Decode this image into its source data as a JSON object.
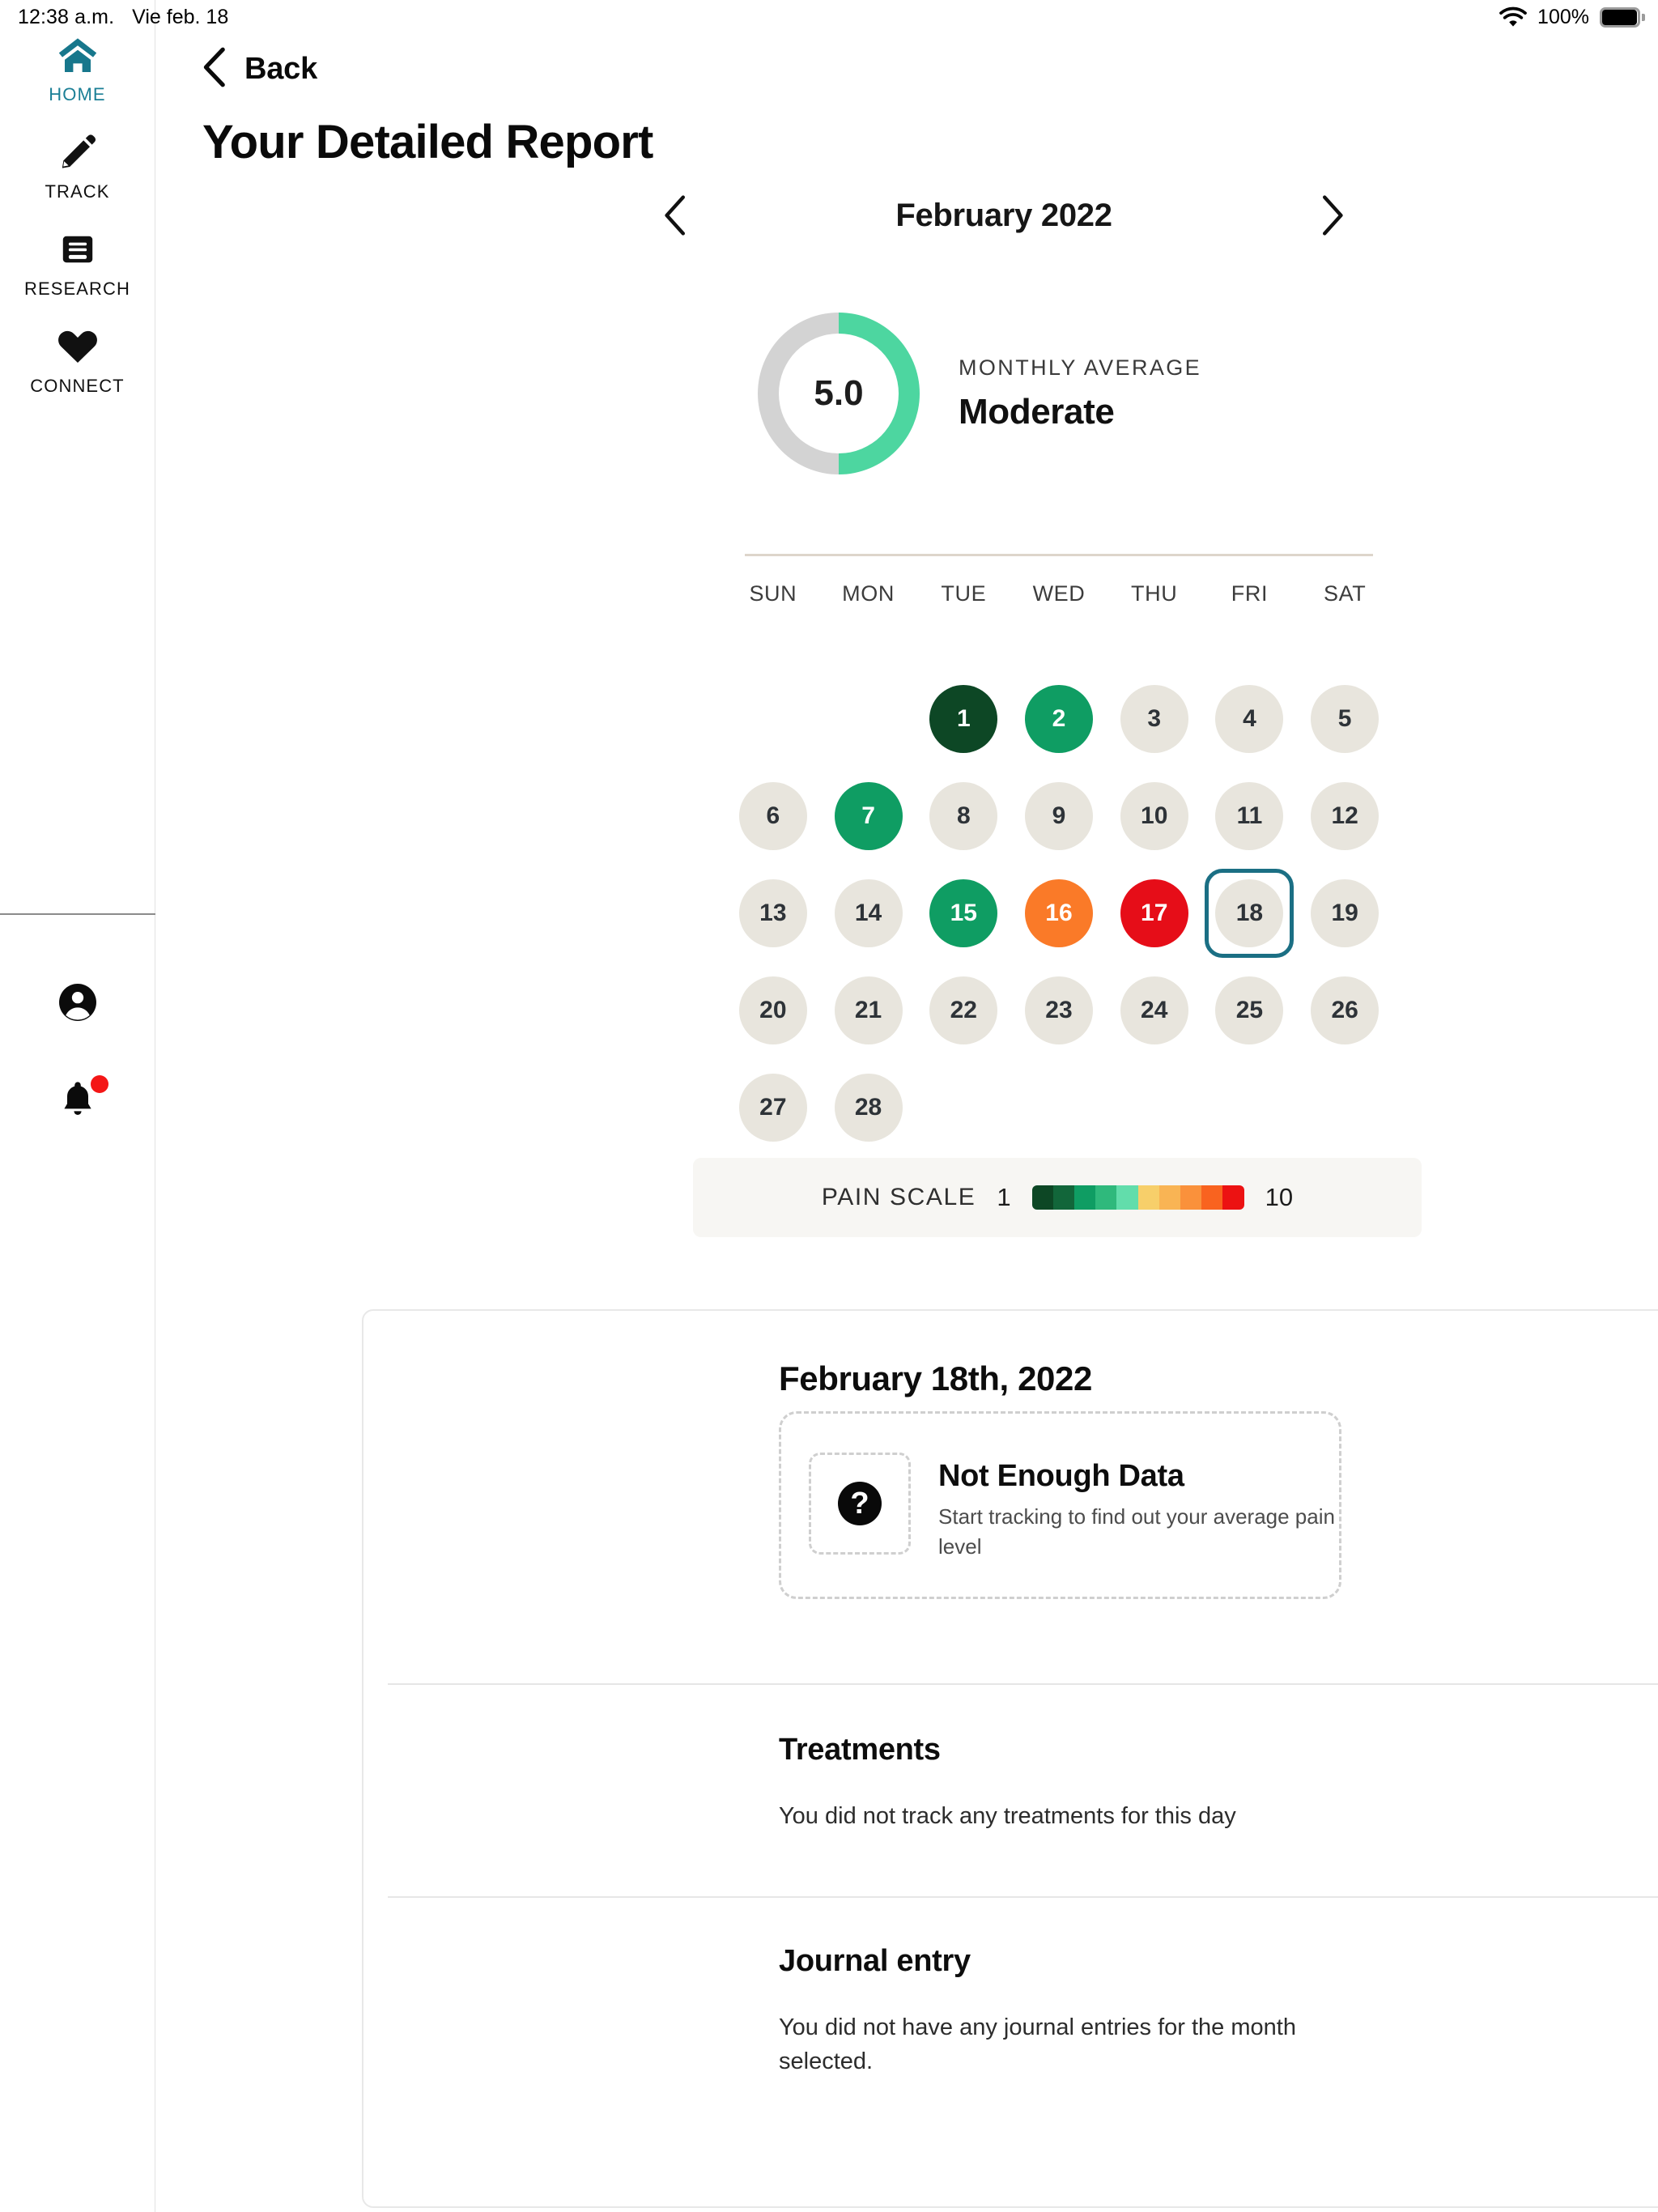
{
  "statusbar": {
    "time": "12:38 a.m.",
    "date": "Vie feb. 18",
    "battery_percent": "100%",
    "wifi_icon": "wifi-icon",
    "battery_icon": "battery-full-icon"
  },
  "sidebar": {
    "items": [
      {
        "label": "HOME",
        "icon": "home-icon",
        "active": true
      },
      {
        "label": "TRACK",
        "icon": "pencil-icon",
        "active": false
      },
      {
        "label": "RESEARCH",
        "icon": "book-icon",
        "active": false
      },
      {
        "label": "CONNECT",
        "icon": "heart-icon",
        "active": false
      }
    ],
    "bottom": [
      {
        "icon": "account-circle-icon",
        "badge": false
      },
      {
        "icon": "bell-icon",
        "badge": true
      }
    ],
    "active_color": "#1b7f96"
  },
  "header": {
    "back_label": "Back",
    "back_icon": "chevron-left-icon",
    "title": "Your Detailed Report"
  },
  "month_nav": {
    "prev_icon": "chevron-left-icon",
    "next_icon": "chevron-right-icon",
    "label": "February 2022"
  },
  "monthly_average": {
    "value": "5.0",
    "caption": "MONTHLY AVERAGE",
    "level": "Moderate",
    "ring_color": "#4dd6a0",
    "track_color": "#d3d3d3",
    "fill_percent": 50
  },
  "calendar": {
    "weekdays": [
      "SUN",
      "MON",
      "TUE",
      "WED",
      "THU",
      "FRI",
      "SAT"
    ],
    "leading_blanks": 2,
    "selected_day": 18,
    "default_color": "#e8e5dd",
    "default_text": "#2e3338",
    "selected_border_color": "#1b6f84",
    "days": [
      {
        "n": 1,
        "color": "#0d4725",
        "text": "#ffffff"
      },
      {
        "n": 2,
        "color": "#0f9d63",
        "text": "#ffffff"
      },
      {
        "n": 3,
        "color": "#e8e5dd",
        "text": "#2e3338"
      },
      {
        "n": 4,
        "color": "#e8e5dd",
        "text": "#2e3338"
      },
      {
        "n": 5,
        "color": "#e8e5dd",
        "text": "#2e3338"
      },
      {
        "n": 6,
        "color": "#e8e5dd",
        "text": "#2e3338"
      },
      {
        "n": 7,
        "color": "#0f9d63",
        "text": "#ffffff"
      },
      {
        "n": 8,
        "color": "#e8e5dd",
        "text": "#2e3338"
      },
      {
        "n": 9,
        "color": "#e8e5dd",
        "text": "#2e3338"
      },
      {
        "n": 10,
        "color": "#e8e5dd",
        "text": "#2e3338"
      },
      {
        "n": 11,
        "color": "#e8e5dd",
        "text": "#2e3338"
      },
      {
        "n": 12,
        "color": "#e8e5dd",
        "text": "#2e3338"
      },
      {
        "n": 13,
        "color": "#e8e5dd",
        "text": "#2e3338"
      },
      {
        "n": 14,
        "color": "#e8e5dd",
        "text": "#2e3338"
      },
      {
        "n": 15,
        "color": "#0f9d63",
        "text": "#ffffff"
      },
      {
        "n": 16,
        "color": "#fa7a28",
        "text": "#ffffff"
      },
      {
        "n": 17,
        "color": "#e60d18",
        "text": "#ffffff"
      },
      {
        "n": 18,
        "color": "#e8e5dd",
        "text": "#2e3338"
      },
      {
        "n": 19,
        "color": "#e8e5dd",
        "text": "#2e3338"
      },
      {
        "n": 20,
        "color": "#e8e5dd",
        "text": "#2e3338"
      },
      {
        "n": 21,
        "color": "#e8e5dd",
        "text": "#2e3338"
      },
      {
        "n": 22,
        "color": "#e8e5dd",
        "text": "#2e3338"
      },
      {
        "n": 23,
        "color": "#e8e5dd",
        "text": "#2e3338"
      },
      {
        "n": 24,
        "color": "#e8e5dd",
        "text": "#2e3338"
      },
      {
        "n": 25,
        "color": "#e8e5dd",
        "text": "#2e3338"
      },
      {
        "n": 26,
        "color": "#e8e5dd",
        "text": "#2e3338"
      },
      {
        "n": 27,
        "color": "#e8e5dd",
        "text": "#2e3338"
      },
      {
        "n": 28,
        "color": "#e8e5dd",
        "text": "#2e3338"
      }
    ]
  },
  "pain_scale": {
    "label": "PAIN SCALE",
    "min": "1",
    "max": "10",
    "colors": [
      "#0d4725",
      "#12663a",
      "#0f9d63",
      "#2fb97c",
      "#62ddab",
      "#f7cf6a",
      "#f9b454",
      "#fa913b",
      "#f9631f",
      "#ec1212"
    ]
  },
  "detail": {
    "date_title": "February 18th, 2022",
    "not_enough_data": {
      "icon": "question-mark-icon",
      "title": "Not Enough Data",
      "subtitle": "Start tracking to find out your average pain level"
    },
    "treatments": {
      "title": "Treatments",
      "body": "You did not track any treatments for this day"
    },
    "journal": {
      "title": "Journal entry",
      "body": "You did not have any journal entries for the month selected."
    }
  }
}
